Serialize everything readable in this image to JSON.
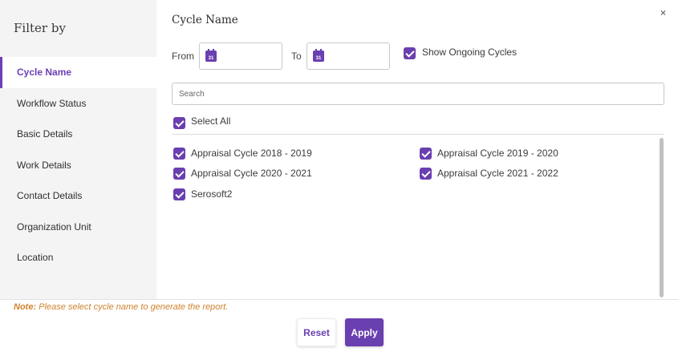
{
  "sidebar": {
    "title": "Filter by",
    "items": [
      {
        "label": "Cycle Name"
      },
      {
        "label": "Workflow Status"
      },
      {
        "label": "Basic Details"
      },
      {
        "label": "Work Details"
      },
      {
        "label": "Contact Details"
      },
      {
        "label": "Organization Unit"
      },
      {
        "label": "Location"
      }
    ]
  },
  "close_symbol": "×",
  "main": {
    "title": "Cycle Name",
    "from_label": "From",
    "to_label": "To",
    "calendar_icon_text": "31",
    "show_ongoing_label": "Show Ongoing Cycles",
    "search_placeholder": "Search",
    "select_all_label": "Select All",
    "cycles": [
      {
        "label": "Appraisal Cycle 2018 - 2019",
        "checked": true
      },
      {
        "label": "Appraisal Cycle 2019 - 2020",
        "checked": true
      },
      {
        "label": "Appraisal Cycle 2020 - 2021",
        "checked": true
      },
      {
        "label": "Appraisal Cycle 2021 - 2022",
        "checked": true
      },
      {
        "label": "Serosoft2",
        "checked": true
      }
    ]
  },
  "footer": {
    "note_prefix": "Note:",
    "note_text": "Please select cycle name to generate the report.",
    "reset_label": "Reset",
    "apply_label": "Apply"
  },
  "colors": {
    "accent": "#6a3fb0",
    "note": "#d0822e",
    "sidebar_bg": "#f4f4f4"
  },
  "icons": {
    "calendar": "calendar-icon",
    "checkbox": "checkbox-checked-icon",
    "close": "close-icon"
  }
}
